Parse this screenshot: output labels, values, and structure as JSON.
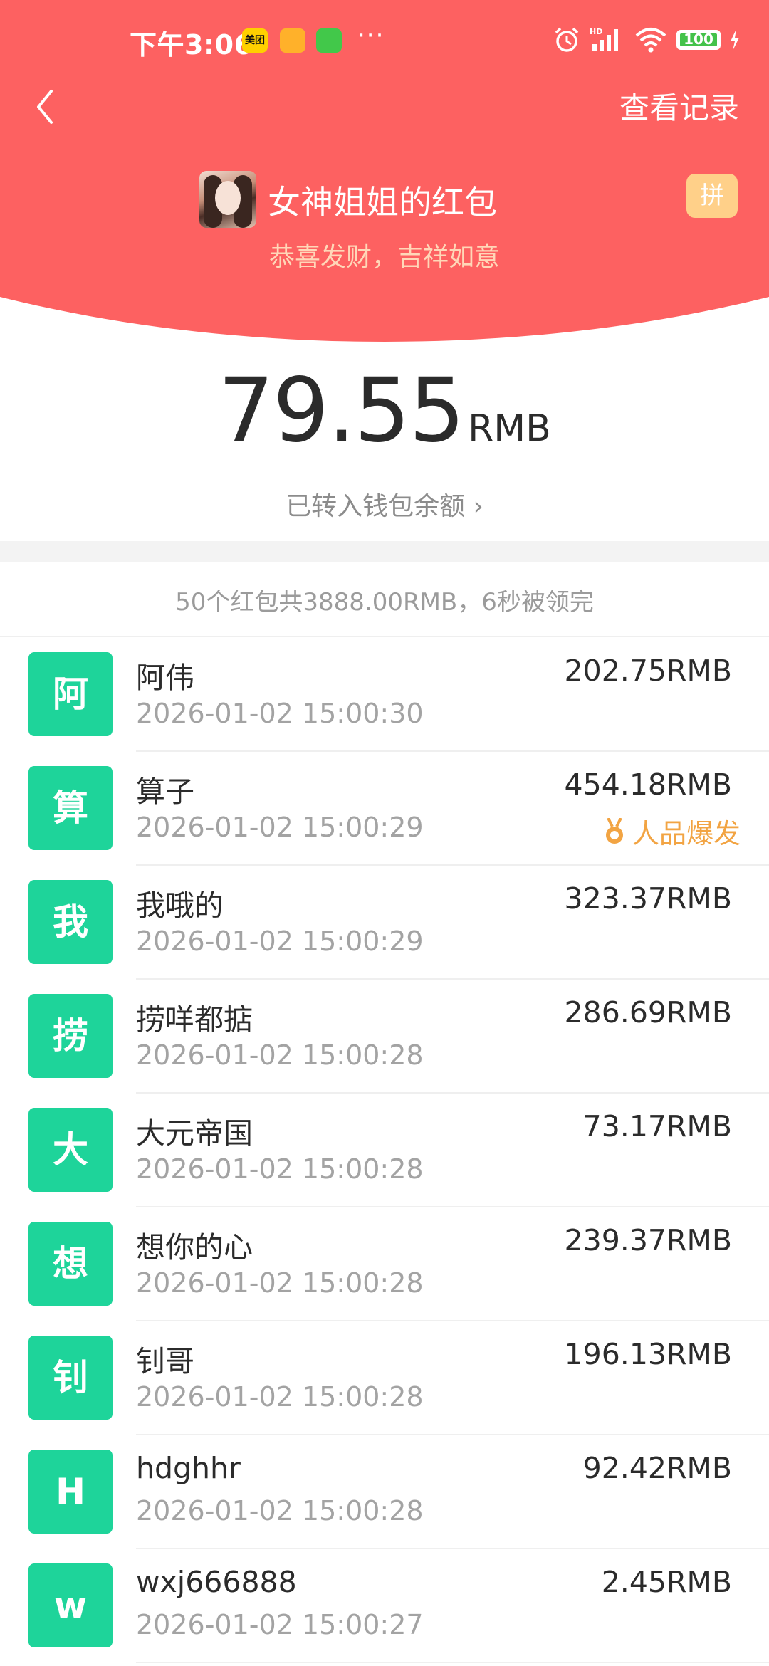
{
  "status_bar": {
    "time": "下午3:06",
    "app_meituan": "美团",
    "more": "···",
    "battery": "100"
  },
  "header": {
    "back_icon": "chevron-left-icon",
    "record_link": "查看记录",
    "title": "女神姐姐的红包",
    "pin_badge": "拼",
    "wish": "恭喜发财，吉祥如意"
  },
  "received": {
    "amount": "79.55",
    "unit": "RMB",
    "wallet_link": "已转入钱包余额 ›"
  },
  "summary": "50个红包共3888.00RMB，6秒被领完",
  "list": [
    {
      "initial": "阿",
      "name": "阿伟",
      "time": "2026-01-02 15:00:30",
      "amount": "202.75RMB"
    },
    {
      "initial": "算",
      "name": "算子",
      "time": "2026-01-02 15:00:29",
      "amount": "454.18RMB",
      "badge": "人品爆发"
    },
    {
      "initial": "我",
      "name": "我哦的",
      "time": "2026-01-02 15:00:29",
      "amount": "323.37RMB"
    },
    {
      "initial": "捞",
      "name": "捞咩都掂",
      "time": "2026-01-02 15:00:28",
      "amount": "286.69RMB"
    },
    {
      "initial": "大",
      "name": "大元帝国",
      "time": "2026-01-02 15:00:28",
      "amount": "73.17RMB"
    },
    {
      "initial": "想",
      "name": "想你的心",
      "time": "2026-01-02 15:00:28",
      "amount": "239.37RMB"
    },
    {
      "initial": "钊",
      "name": "钊哥",
      "time": "2026-01-02 15:00:28",
      "amount": "196.13RMB"
    },
    {
      "initial": "H",
      "name": "hdghhr",
      "time": "2026-01-02 15:00:28",
      "amount": "92.42RMB"
    },
    {
      "initial": "w",
      "name": "wxj666888",
      "time": "2026-01-02 15:00:27",
      "amount": "2.45RMB"
    }
  ],
  "colors": {
    "header_red": "#fd6161",
    "avatar_green": "#1ed49a",
    "luck_badge": "#f2a443",
    "wish_text": "#ffd7b8"
  }
}
